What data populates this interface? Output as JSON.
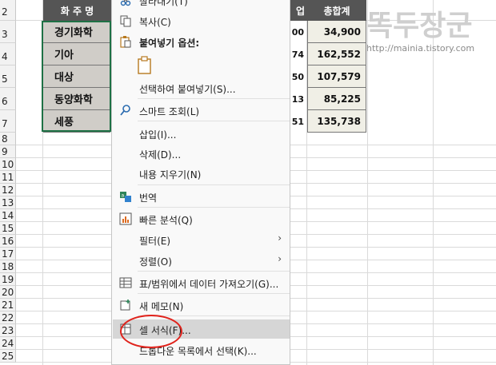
{
  "sheet": {
    "row_numbers": [
      "2",
      "3",
      "4",
      "5",
      "6",
      "7",
      "8",
      "9",
      "10",
      "11",
      "12",
      "13",
      "14",
      "15",
      "16",
      "17",
      "18",
      "19",
      "20",
      "21",
      "22",
      "23",
      "24",
      "25"
    ],
    "header": {
      "col_b": "화 주 명",
      "col_partial": "업",
      "col_total": "총합계"
    },
    "rows": [
      {
        "name": "경기화학",
        "partial": "00",
        "total": "34,900"
      },
      {
        "name": "기아",
        "partial": "74",
        "total": "162,552"
      },
      {
        "name": "대상",
        "partial": "50",
        "total": "107,579"
      },
      {
        "name": "동양화학",
        "partial": "13",
        "total": "85,225"
      },
      {
        "name": "세풍",
        "partial": "51",
        "total": "135,738"
      }
    ],
    "colors": {
      "header_bg": "#555555",
      "name_bg": "#d0cdc8",
      "total_bg": "#f0efe6",
      "selection": "#1e7145"
    }
  },
  "watermark": {
    "title": "똑두장군",
    "url": "http://mainia.tistory.com"
  },
  "context_menu": {
    "cut_partial": "잘라내기(T)",
    "copy": "복사(C)",
    "paste_options": "붙여넣기 옵션:",
    "paste_special": "선택하여 붙여넣기(S)...",
    "smart_lookup": "스마트 조회(L)",
    "insert": "삽입(I)...",
    "delete": "삭제(D)...",
    "clear_contents": "내용 지우기(N)",
    "translate": "번역",
    "quick_analysis": "빠른 분석(Q)",
    "filter": "필터(E)",
    "sort": "정렬(O)",
    "get_data": "표/범위에서 데이터 가져오기(G)...",
    "new_note": "새 메모(N)",
    "format_cells": "셀 서식(F)...",
    "pick_from_list": "드롭다운 목록에서 선택(K)..."
  },
  "annotation_color": "#e0231c"
}
